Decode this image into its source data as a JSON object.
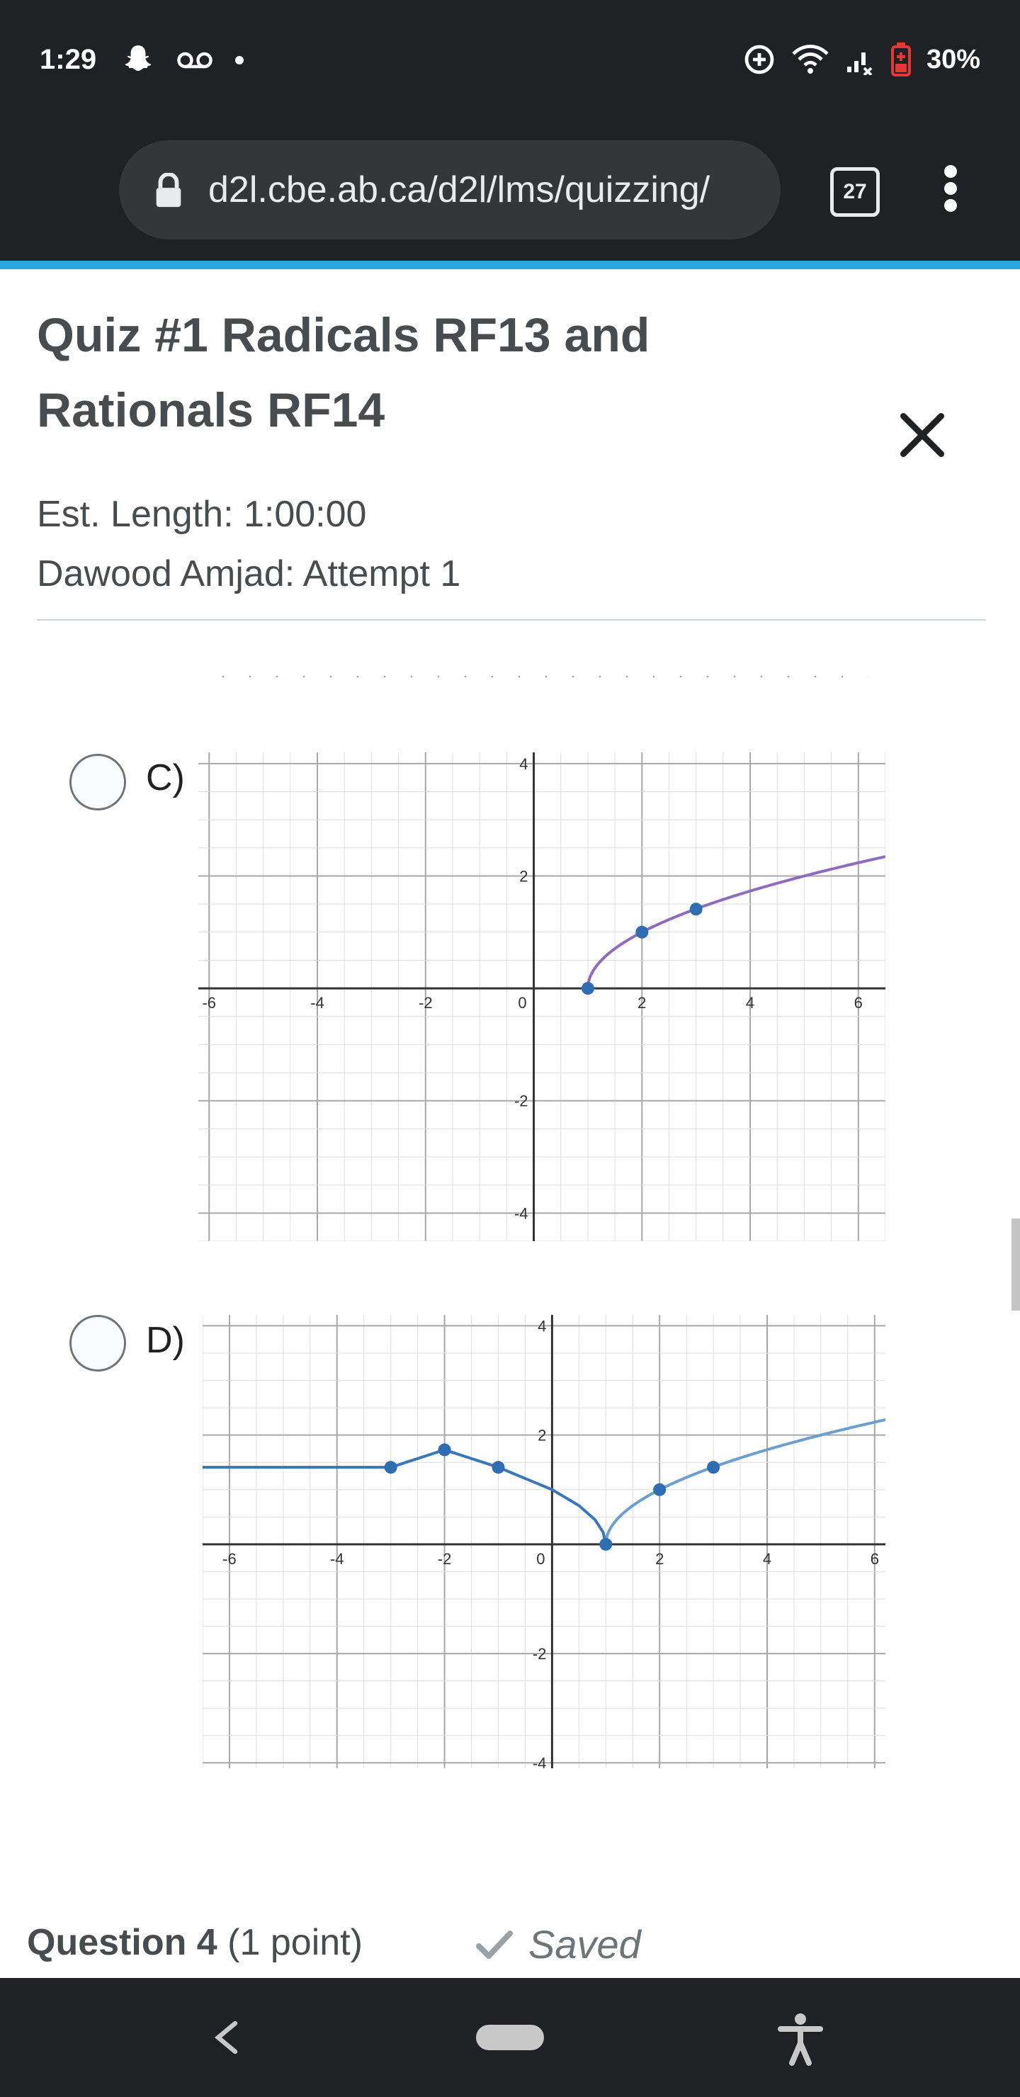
{
  "status_bar": {
    "time": "1:29",
    "battery": "30%",
    "icons": [
      "snapchat-icon",
      "voicemail-icon",
      "dot-icon",
      "data-saver-icon",
      "wifi-icon",
      "signal-icon",
      "battery-low-icon"
    ]
  },
  "browser": {
    "url": "d2l.cbe.ab.ca/d2l/lms/quizzing/",
    "tab_count": "27"
  },
  "quiz": {
    "title": "Quiz #1 Radicals RF13 and Rationals RF14",
    "est_length": "Est. Length: 1:00:00",
    "attempt": "Dawood Amjad: Attempt 1"
  },
  "options": [
    {
      "label": "C)",
      "selected": false
    },
    {
      "label": "D)",
      "selected": false
    }
  ],
  "chart_data": [
    {
      "type": "line",
      "xlim": [
        -6.2,
        6.5
      ],
      "ylim": [
        -4.5,
        4.2
      ],
      "x_ticks": [
        "-6",
        "-4",
        "-2",
        "0",
        "2",
        "4",
        "6"
      ],
      "y_ticks": [
        "4",
        "2",
        "-2",
        "-4"
      ],
      "grid": true,
      "series": [
        {
          "color": "#8e6bbf",
          "function": "sqrt(x-1)",
          "x_range": [
            1,
            6.5
          ]
        }
      ],
      "points": [
        {
          "x": 1,
          "y": 0
        },
        {
          "x": 2,
          "y": 1
        },
        {
          "x": 3,
          "y": 1.41
        }
      ]
    },
    {
      "type": "line",
      "xlim": [
        -6.5,
        6.2
      ],
      "ylim": [
        -4.1,
        4.2
      ],
      "x_ticks": [
        "-6",
        "-4",
        "-2",
        "0",
        "2",
        "4",
        "6"
      ],
      "y_ticks": [
        "4",
        "2",
        "-2",
        "-4"
      ],
      "grid": true,
      "series": [
        {
          "color": "#3a76b8",
          "x": [
            -6.5,
            -3,
            -2,
            -1,
            0,
            0.5,
            0.8,
            0.95,
            1
          ],
          "y": [
            1.41,
            1.41,
            1.73,
            1.41,
            1,
            0.71,
            0.45,
            0.22,
            0
          ]
        },
        {
          "color": "#6b9fd0",
          "function": "sqrt(x-1)",
          "x_range": [
            1,
            6.5
          ]
        }
      ],
      "points": [
        {
          "x": -3,
          "y": 1.41
        },
        {
          "x": -2,
          "y": 1.73
        },
        {
          "x": -1,
          "y": 1.41
        },
        {
          "x": 1,
          "y": 0
        },
        {
          "x": 2,
          "y": 1
        },
        {
          "x": 3,
          "y": 1.41
        }
      ]
    }
  ],
  "question": {
    "label": "Question 4",
    "points": "(1 point)",
    "status": "Saved"
  }
}
